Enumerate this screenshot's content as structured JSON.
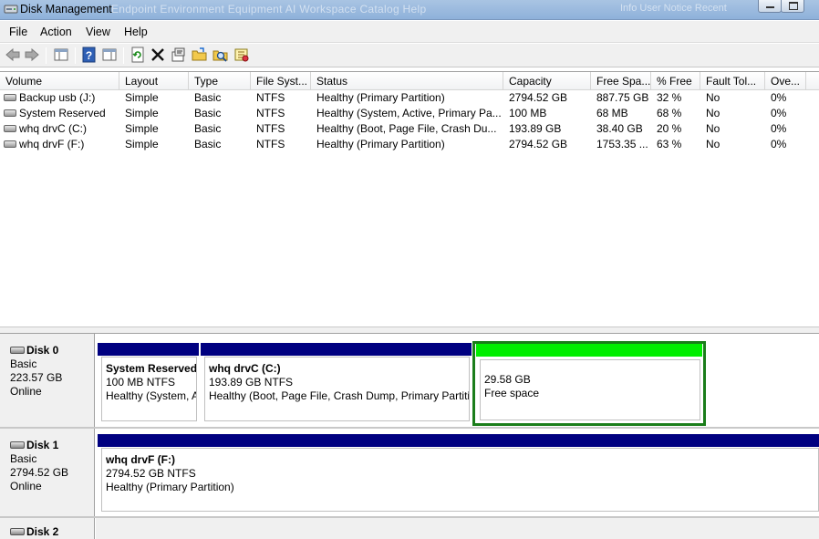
{
  "window": {
    "title": "Disk Management",
    "ghost_text": "Endpoint   Environment   Equipment   AI   Workspace   Catalog   Help",
    "ghost_right": "Info   User   Notice   Recent"
  },
  "menu": [
    "File",
    "Action",
    "View",
    "Help"
  ],
  "toolbar_icons": [
    "back-arrow-icon",
    "forward-arrow-icon",
    "console-tree-icon",
    "help-icon",
    "properties-pane-icon",
    "refresh-icon",
    "delete-icon",
    "properties-icon",
    "open-icon",
    "explore-icon",
    "rescan-icon"
  ],
  "columns": [
    "Volume",
    "Layout",
    "Type",
    "File Syst...",
    "Status",
    "Capacity",
    "Free Spa...",
    "% Free",
    "Fault Tol...",
    "Ove..."
  ],
  "volumes": [
    {
      "volume": "Backup usb (J:)",
      "layout": "Simple",
      "type": "Basic",
      "fs": "NTFS",
      "status": "Healthy (Primary Partition)",
      "capacity": "2794.52 GB",
      "free": "887.75 GB",
      "pct": "32 %",
      "fault": "No",
      "overhead": "0%"
    },
    {
      "volume": "System Reserved",
      "layout": "Simple",
      "type": "Basic",
      "fs": "NTFS",
      "status": "Healthy (System, Active, Primary Pa...",
      "capacity": "100 MB",
      "free": "68 MB",
      "pct": "68 %",
      "fault": "No",
      "overhead": "0%"
    },
    {
      "volume": "whq drvC (C:)",
      "layout": "Simple",
      "type": "Basic",
      "fs": "NTFS",
      "status": "Healthy (Boot, Page File, Crash Du...",
      "capacity": "193.89 GB",
      "free": "38.40 GB",
      "pct": "20 %",
      "fault": "No",
      "overhead": "0%"
    },
    {
      "volume": "whq drvF (F:)",
      "layout": "Simple",
      "type": "Basic",
      "fs": "NTFS",
      "status": "Healthy (Primary Partition)",
      "capacity": "2794.52 GB",
      "free": "1753.35 ...",
      "pct": "63 %",
      "fault": "No",
      "overhead": "0%"
    }
  ],
  "disks": [
    {
      "name": "Disk 0",
      "kind": "Basic",
      "size": "223.57 GB",
      "state": "Online",
      "partitions": [
        {
          "name": "System Reserved",
          "size": "100 MB NTFS",
          "status": "Healthy (System, Active, Primary Partition)"
        },
        {
          "name": "whq drvC  (C:)",
          "size": "193.89 GB NTFS",
          "status": "Healthy (Boot, Page File, Crash Dump, Primary Partition)"
        },
        {
          "name": "",
          "size": "29.58 GB",
          "status": "Free space"
        }
      ]
    },
    {
      "name": "Disk 1",
      "kind": "Basic",
      "size": "2794.52 GB",
      "state": "Online",
      "partitions": [
        {
          "name": "whq drvF  (F:)",
          "size": "2794.52 GB NTFS",
          "status": "Healthy (Primary Partition)"
        }
      ]
    },
    {
      "name": "Disk 2"
    }
  ],
  "colors": {
    "primary_partition": "#000080",
    "free_space": "#00ee00",
    "selection_frame": "#1a7d1a"
  }
}
